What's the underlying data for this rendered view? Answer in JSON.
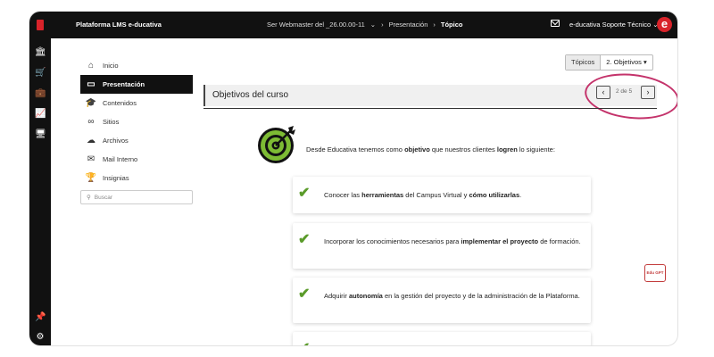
{
  "topbar": {
    "app_title": "Plataforma LMS e-ducativa",
    "crumb_role": "Ser Webmaster del _26.00.00-11",
    "crumb_section": "Presentación",
    "crumb_current": "Tópico",
    "user_label": "e-ducativa Soporte Técnico",
    "badge_letter": "e"
  },
  "nav": {
    "items": [
      {
        "label": "Inicio",
        "icon": "home-icon"
      },
      {
        "label": "Presentación",
        "icon": "monitor-icon"
      },
      {
        "label": "Contenidos",
        "icon": "graduation-cap-icon"
      },
      {
        "label": "Sitios",
        "icon": "link-icon"
      },
      {
        "label": "Archivos",
        "icon": "cloud-icon"
      },
      {
        "label": "Mail Interno",
        "icon": "mail-icon"
      },
      {
        "label": "Insignias",
        "icon": "trophy-icon"
      }
    ],
    "search_placeholder": "Buscar"
  },
  "topic_selector": {
    "label": "Tópicos",
    "value": "2. Objetivos"
  },
  "section": {
    "title": "Objetivos del curso"
  },
  "pager": {
    "text": "2 de 5"
  },
  "intro": {
    "pre": "Desde Educativa tenemos como ",
    "b1": "objetivo",
    "mid": " que nuestros clientes ",
    "b2": "logren",
    "post": " lo siguiente:"
  },
  "cards": [
    {
      "a": "Conocer las ",
      "b": "herramientas",
      "c": " del Campus Virtual y ",
      "d": "cómo utilizarlas",
      "e": "."
    },
    {
      "a": "Incorporar los conocimientos necesarios para ",
      "b": "implementar el proyecto",
      "c": " de formación.",
      "d": "",
      "e": ""
    },
    {
      "a": "Adquirir ",
      "b": "autonomía",
      "c": " en la gestión del proyecto y de la administración de la Plataforma.",
      "d": "",
      "e": ""
    }
  ],
  "gpt_label": "Edu GPT",
  "colors": {
    "accent_red": "#d8232a",
    "check_green": "#5a9b2a",
    "highlight_circle": "#c4336b"
  }
}
